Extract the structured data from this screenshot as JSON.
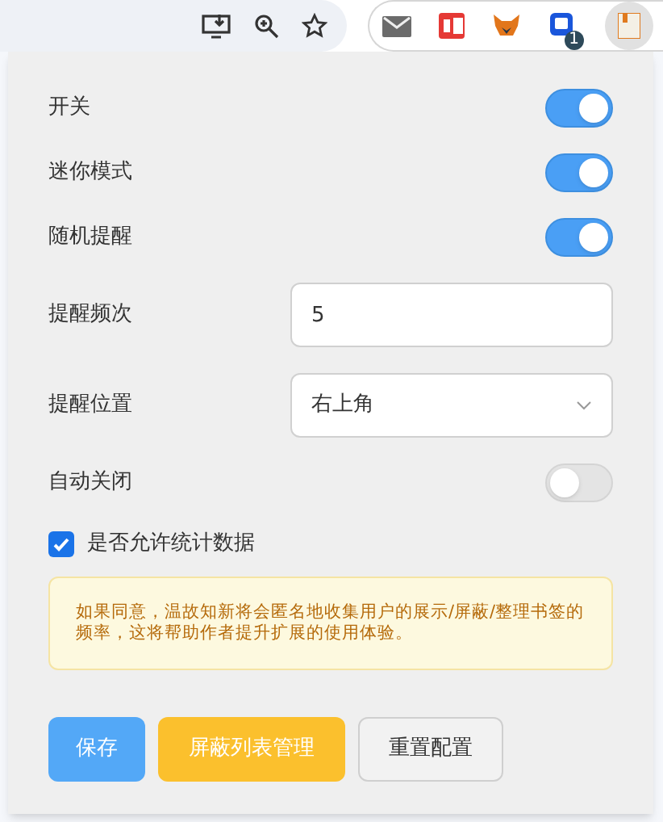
{
  "toolbar": {
    "extension_badge": "1"
  },
  "settings": [
    {
      "kind": "toggle",
      "label": "开关",
      "on": true
    },
    {
      "kind": "toggle",
      "label": "迷你模式",
      "on": true
    },
    {
      "kind": "toggle",
      "label": "随机提醒",
      "on": true
    },
    {
      "kind": "number",
      "label": "提醒频次",
      "value": "5"
    },
    {
      "kind": "select",
      "label": "提醒位置",
      "value": "右上角"
    },
    {
      "kind": "toggle",
      "label": "自动关闭",
      "on": false
    },
    {
      "kind": "checkbox",
      "label": "是否允许统计数据",
      "checked": true
    }
  ],
  "notice": "如果同意，温故知新将会匿名地收集用户的展示/屏蔽/整理书签的频率，这将帮助作者提升扩展的使用体验。",
  "buttons": [
    {
      "kind": "primary",
      "label": "保存"
    },
    {
      "kind": "warning",
      "label": "屏蔽列表管理"
    },
    {
      "kind": "default",
      "label": "重置配置"
    }
  ]
}
